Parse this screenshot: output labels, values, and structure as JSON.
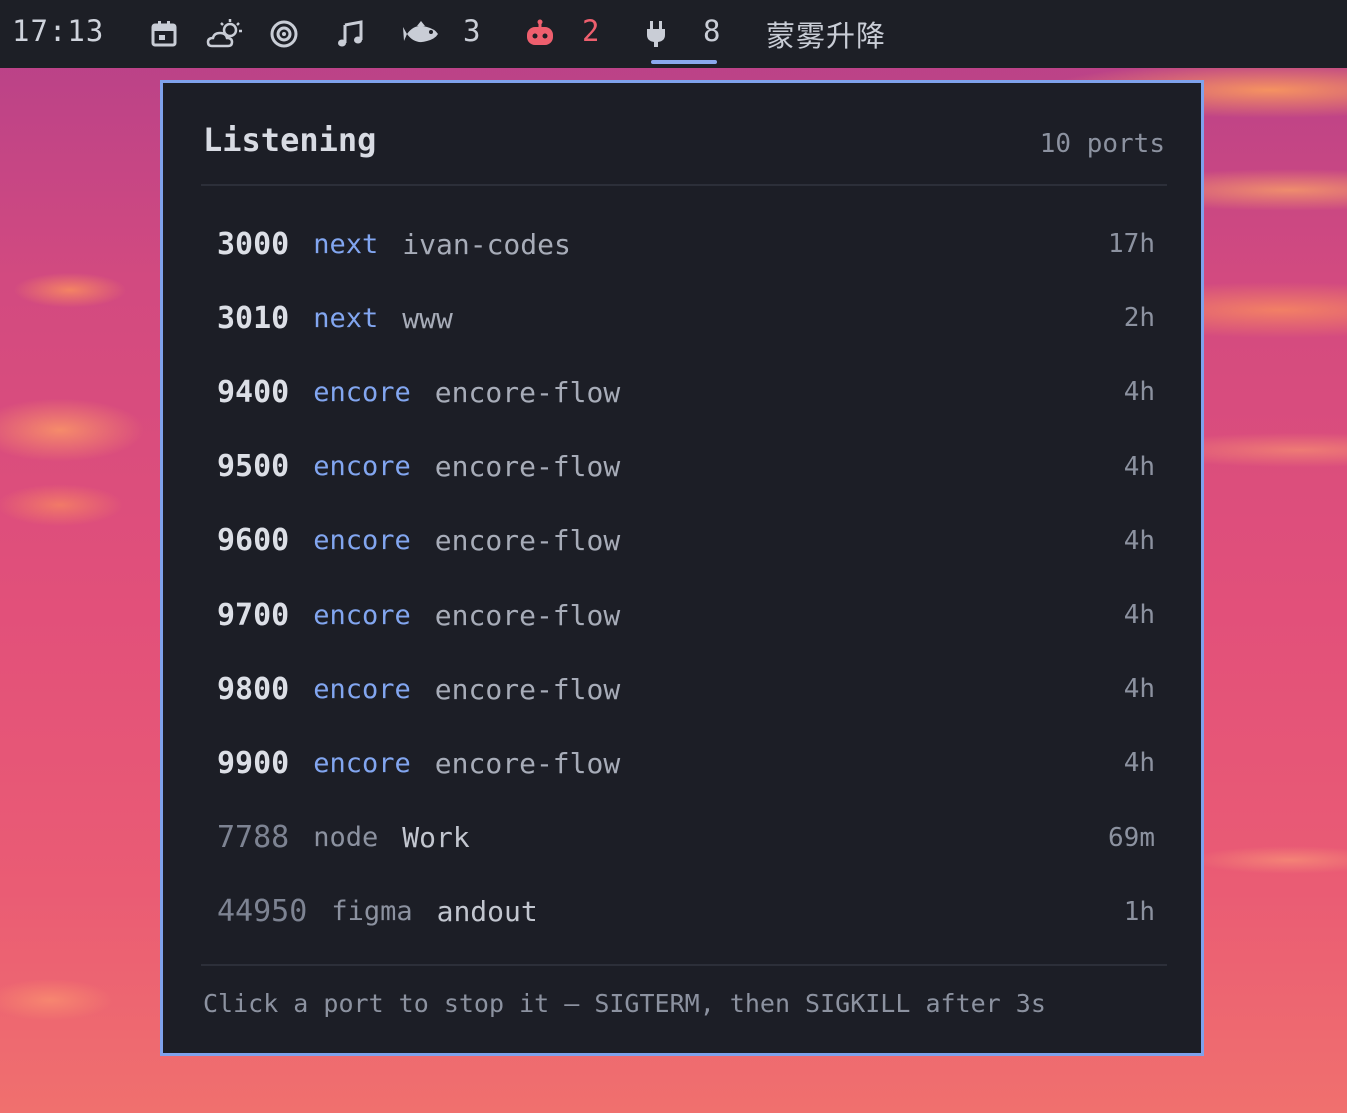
{
  "topbar": {
    "time": "17:13",
    "icons": [
      "calendar-icon",
      "weather-icon",
      "focus-icon",
      "music-icon",
      "fish-icon",
      "robot-icon",
      "plug-icon"
    ],
    "fish_count": "3",
    "robot_count": "2",
    "plug_count": "8",
    "workspace_label": "蒙雾升降",
    "colors": {
      "alert": "#ee5f6e",
      "active_underline": "#8aa8ee"
    }
  },
  "popup": {
    "title": "Listening",
    "count": "10 ports",
    "ports": [
      {
        "port": "3000",
        "process": "next",
        "name": "ivan-codes",
        "age": "17h",
        "dim": false
      },
      {
        "port": "3010",
        "process": "next",
        "name": "www",
        "age": "2h",
        "dim": false
      },
      {
        "port": "9400",
        "process": "encore",
        "name": "encore-flow",
        "age": "4h",
        "dim": false
      },
      {
        "port": "9500",
        "process": "encore",
        "name": "encore-flow",
        "age": "4h",
        "dim": false
      },
      {
        "port": "9600",
        "process": "encore",
        "name": "encore-flow",
        "age": "4h",
        "dim": false
      },
      {
        "port": "9700",
        "process": "encore",
        "name": "encore-flow",
        "age": "4h",
        "dim": false
      },
      {
        "port": "9800",
        "process": "encore",
        "name": "encore-flow",
        "age": "4h",
        "dim": false
      },
      {
        "port": "9900",
        "process": "encore",
        "name": "encore-flow",
        "age": "4h",
        "dim": false
      },
      {
        "port": "7788",
        "process": "node",
        "name": "Work",
        "age": "69m",
        "dim": true
      },
      {
        "port": "44950",
        "process": "figma",
        "name": "andout",
        "age": "1h",
        "dim": true
      }
    ],
    "footer": "Click a port to stop it — SIGTERM, then SIGKILL after 3s",
    "colors": {
      "border": "#7fa2ec",
      "process": "#82a6f0"
    }
  }
}
